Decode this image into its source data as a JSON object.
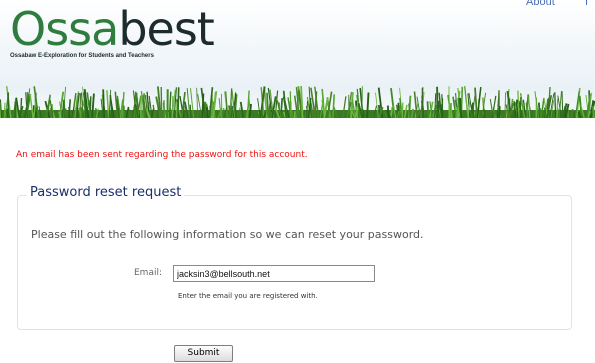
{
  "header": {
    "logo_text_a": "Ossa",
    "logo_text_b": "best",
    "tagline": "Ossabaw E-Exploration for Students and Teachers",
    "nav_about": "About",
    "nav_second": "I"
  },
  "alert": {
    "message": "An email has been sent regarding the password for this account."
  },
  "form": {
    "legend": "Password reset request",
    "instructions": "Please fill out the following information so we can reset your password.",
    "email_label": "Email:",
    "email_value": "jacksin3@bellsouth.net",
    "email_help": "Enter the email you are registered with.",
    "submit_label": "Submit"
  },
  "colors": {
    "alert": "#ee1111",
    "legend": "#1a2f6b",
    "logo_green": "#2e7d3e"
  }
}
